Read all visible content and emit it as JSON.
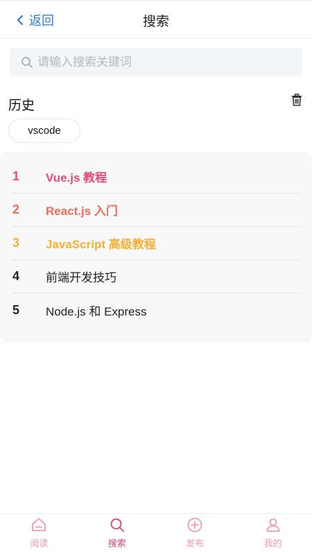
{
  "header": {
    "back_label": "返回",
    "title": "搜索"
  },
  "search": {
    "placeholder": "请输入搜索关键词",
    "value": ""
  },
  "history": {
    "title": "历史",
    "items": [
      "vscode"
    ]
  },
  "hot_list": [
    {
      "rank": "1",
      "text": "Vue.js 教程"
    },
    {
      "rank": "2",
      "text": "React.js 入门"
    },
    {
      "rank": "3",
      "text": "JavaScript 高级教程"
    },
    {
      "rank": "4",
      "text": "前端开发技巧"
    },
    {
      "rank": "5",
      "text": "Node.js 和 Express"
    }
  ],
  "tabbar": {
    "active": "search",
    "items": [
      {
        "key": "read",
        "label": "阅读",
        "icon": "home-icon"
      },
      {
        "key": "search",
        "label": "搜索",
        "icon": "search-icon"
      },
      {
        "key": "publish",
        "label": "发布",
        "icon": "plus-circle-icon"
      },
      {
        "key": "mine",
        "label": "我的",
        "icon": "user-icon"
      }
    ]
  },
  "colors": {
    "accent": "#e0487a",
    "link": "#2b7de9",
    "rank1": "#e94a7a",
    "rank2": "#f36a5a",
    "rank3": "#fbb033",
    "tab_inactive": "#f29aa6"
  }
}
